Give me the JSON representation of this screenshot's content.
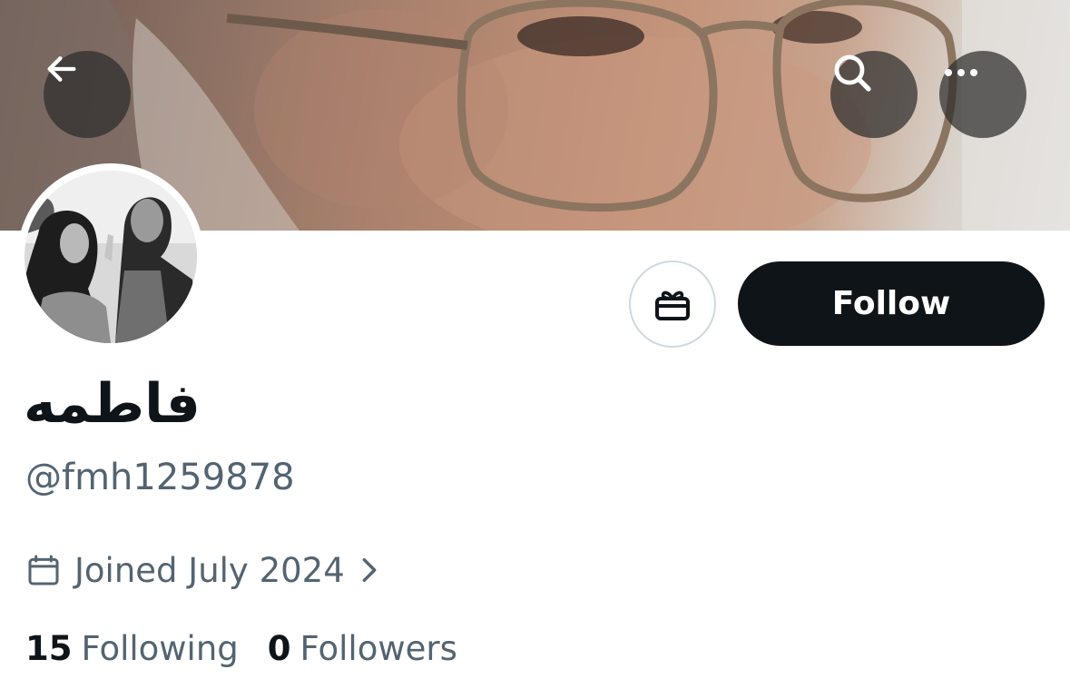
{
  "header": {
    "back_icon": "arrow-left-icon",
    "search_icon": "search-icon",
    "more_icon": "more-horizontal-icon"
  },
  "profile": {
    "display_name": "فاطمه",
    "handle": "@fmh1259878",
    "joined": "Joined July 2024",
    "following_count": "15",
    "following_label": "Following",
    "followers_count": "0",
    "followers_label": "Followers"
  },
  "actions": {
    "gift_icon": "gift-icon",
    "follow_label": "Follow"
  },
  "colors": {
    "primary_text": "#0f1419",
    "secondary_text": "#536471",
    "follow_bg": "#0f1419",
    "border": "#cfd9de"
  }
}
